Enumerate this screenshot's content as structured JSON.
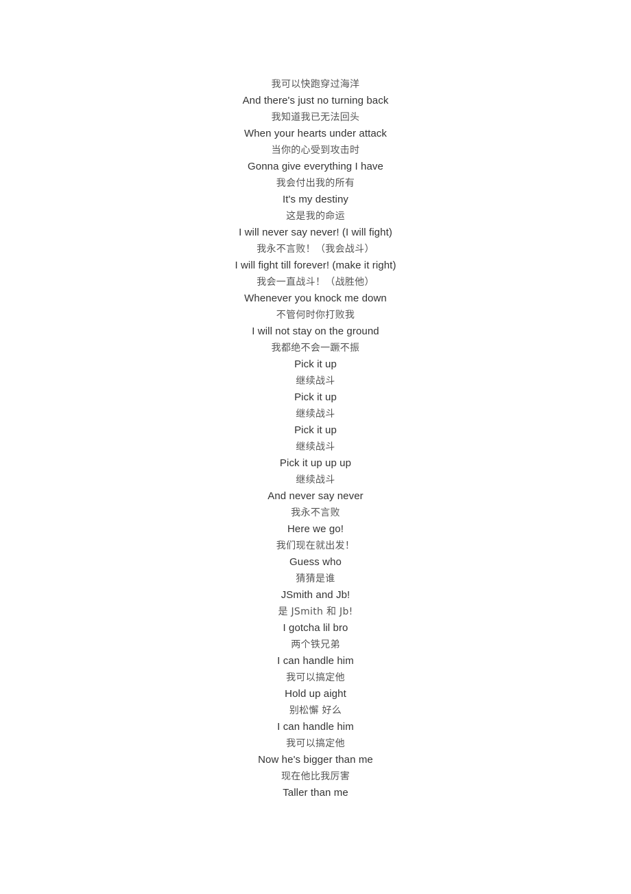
{
  "document": {
    "background_color": "#ffffff",
    "english_text_color": "#333333",
    "chinese_text_color": "#555555",
    "lines": [
      {
        "lang": "zh",
        "text": "我可以快跑穿过海洋"
      },
      {
        "lang": "en",
        "text": "And there's just no turning back"
      },
      {
        "lang": "zh",
        "text": "我知道我已无法回头"
      },
      {
        "lang": "en",
        "text": "When your hearts under attack"
      },
      {
        "lang": "zh",
        "text": "当你的心受到攻击时"
      },
      {
        "lang": "en",
        "text": "Gonna give everything I have"
      },
      {
        "lang": "zh",
        "text": "我会付出我的所有"
      },
      {
        "lang": "en",
        "text": "It's my destiny"
      },
      {
        "lang": "zh",
        "text": "这是我的命运"
      },
      {
        "lang": "en",
        "text": "I will never say never! (I will fight)"
      },
      {
        "lang": "zh",
        "text": "我永不言败！（我会战斗）"
      },
      {
        "lang": "en",
        "text": "I will fight till forever! (make it right)"
      },
      {
        "lang": "zh",
        "text": "我会一直战斗！（战胜他）"
      },
      {
        "lang": "en",
        "text": "Whenever you knock me down"
      },
      {
        "lang": "zh",
        "text": "不管何时你打败我"
      },
      {
        "lang": "en",
        "text": "I will not stay on the ground"
      },
      {
        "lang": "zh",
        "text": "我都绝不会一蹶不振"
      },
      {
        "lang": "en",
        "text": "Pick it up"
      },
      {
        "lang": "zh",
        "text": "继续战斗"
      },
      {
        "lang": "en",
        "text": "Pick it up"
      },
      {
        "lang": "zh",
        "text": "继续战斗"
      },
      {
        "lang": "en",
        "text": "Pick it up"
      },
      {
        "lang": "zh",
        "text": "继续战斗"
      },
      {
        "lang": "en",
        "text": "Pick it up up up"
      },
      {
        "lang": "zh",
        "text": "继续战斗"
      },
      {
        "lang": "en",
        "text": "And never say never"
      },
      {
        "lang": "zh",
        "text": "我永不言败"
      },
      {
        "lang": "en",
        "text": "Here we go!"
      },
      {
        "lang": "zh",
        "text": "我们现在就出发！"
      },
      {
        "lang": "en",
        "text": "Guess who"
      },
      {
        "lang": "zh",
        "text": "猜猜是谁"
      },
      {
        "lang": "en",
        "text": "JSmith and Jb!"
      },
      {
        "lang": "zh",
        "text": "是 JSmith 和 Jb!"
      },
      {
        "lang": "en",
        "text": "I gotcha lil bro"
      },
      {
        "lang": "zh",
        "text": "两个铁兄弟"
      },
      {
        "lang": "en",
        "text": "I can handle him"
      },
      {
        "lang": "zh",
        "text": "我可以搞定他"
      },
      {
        "lang": "en",
        "text": "Hold up aight"
      },
      {
        "lang": "zh",
        "text": "别松懈 好么"
      },
      {
        "lang": "en",
        "text": "I can handle him"
      },
      {
        "lang": "zh",
        "text": "我可以搞定他"
      },
      {
        "lang": "en",
        "text": "Now he's bigger than me"
      },
      {
        "lang": "zh",
        "text": "现在他比我厉害"
      },
      {
        "lang": "en",
        "text": "Taller than me"
      }
    ]
  }
}
